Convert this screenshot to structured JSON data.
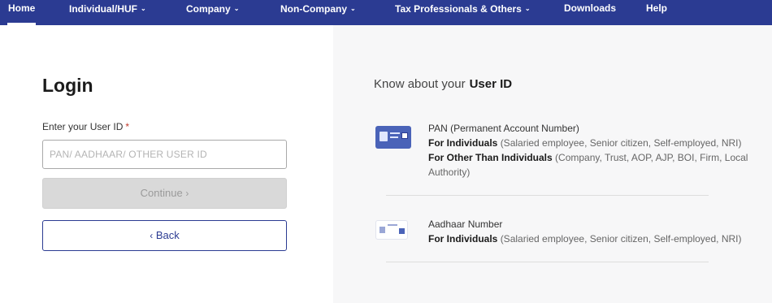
{
  "nav": {
    "items": [
      {
        "label": "Home",
        "has_caret": false,
        "active": true
      },
      {
        "label": "Individual/HUF",
        "has_caret": true
      },
      {
        "label": "Company",
        "has_caret": true
      },
      {
        "label": "Non-Company",
        "has_caret": true
      },
      {
        "label": "Tax Professionals & Others",
        "has_caret": true
      },
      {
        "label": "Downloads",
        "has_caret": false
      },
      {
        "label": "Help",
        "has_caret": false
      }
    ]
  },
  "login": {
    "title": "Login",
    "field_label": "Enter your User ID",
    "required_mark": "*",
    "input_value": "",
    "input_placeholder": "PAN/ AADHAAR/ OTHER USER ID",
    "continue_label": "Continue",
    "continue_chevron": "›",
    "back_label": "Back",
    "back_chevron": "‹"
  },
  "know": {
    "title_prefix": "Know about your",
    "title_strong": "User ID",
    "rows": [
      {
        "icon": "pan-card-icon",
        "title": "PAN (Permanent Account Number)",
        "line1_bold": "For Individuals",
        "line1_rest": "(Salaried employee, Senior citizen, Self-employed, NRI)",
        "line2_bold": "For Other Than Individuals",
        "line2_rest": "(Company, Trust, AOP, AJP, BOI, Firm, Local Authority)"
      },
      {
        "icon": "aadhaar-card-icon",
        "title": "Aadhaar Number",
        "line1_bold": "For Individuals",
        "line1_rest": "(Salaried employee, Senior citizen, Self-employed, NRI)"
      }
    ]
  },
  "colors": {
    "nav_bg": "#2b3b92",
    "accent": "#2b3b92",
    "disabled_btn": "#d9d9d9",
    "right_panel_bg": "#f7f7f8",
    "required": "#c0392b"
  }
}
